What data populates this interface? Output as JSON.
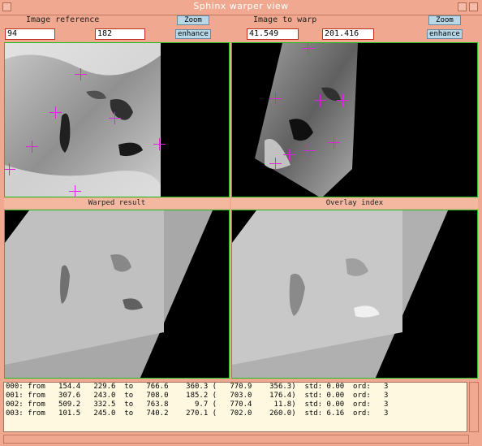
{
  "window": {
    "title": "Sphinx warper view"
  },
  "reference": {
    "label": "Image reference",
    "x_value": "94",
    "y_value": "182",
    "zoom_label": "Zoom",
    "enhance_label": "enhance"
  },
  "warp": {
    "label": "Image to warp",
    "x_value": "41.549",
    "y_value": "201.416",
    "zoom_label": "Zoom",
    "enhance_label": "enhance"
  },
  "panes": {
    "warped_result": "Warped result",
    "overlay_index": "Overlay index"
  },
  "log": [
    "000: from   154.4   229.6  to   766.6    360.3 (   770.9    356.3)  std: 0.00  ord:   3",
    "001: from   307.6   243.0  to   708.0    185.2 (   703.0    176.4)  std: 0.00  ord:   3",
    "002: from   509.2   332.5  to   763.8      9.7 (   770.4     11.8)  std: 0.00  ord:   3",
    "003: from   101.5   245.0  to   740.2    270.1 (   702.0    260.0)  std: 6.16  ord:   3"
  ],
  "colors": {
    "background": "#f0a890",
    "pane_border": "#20c020",
    "marker": "#e020e0",
    "field_border": "#c03020"
  }
}
